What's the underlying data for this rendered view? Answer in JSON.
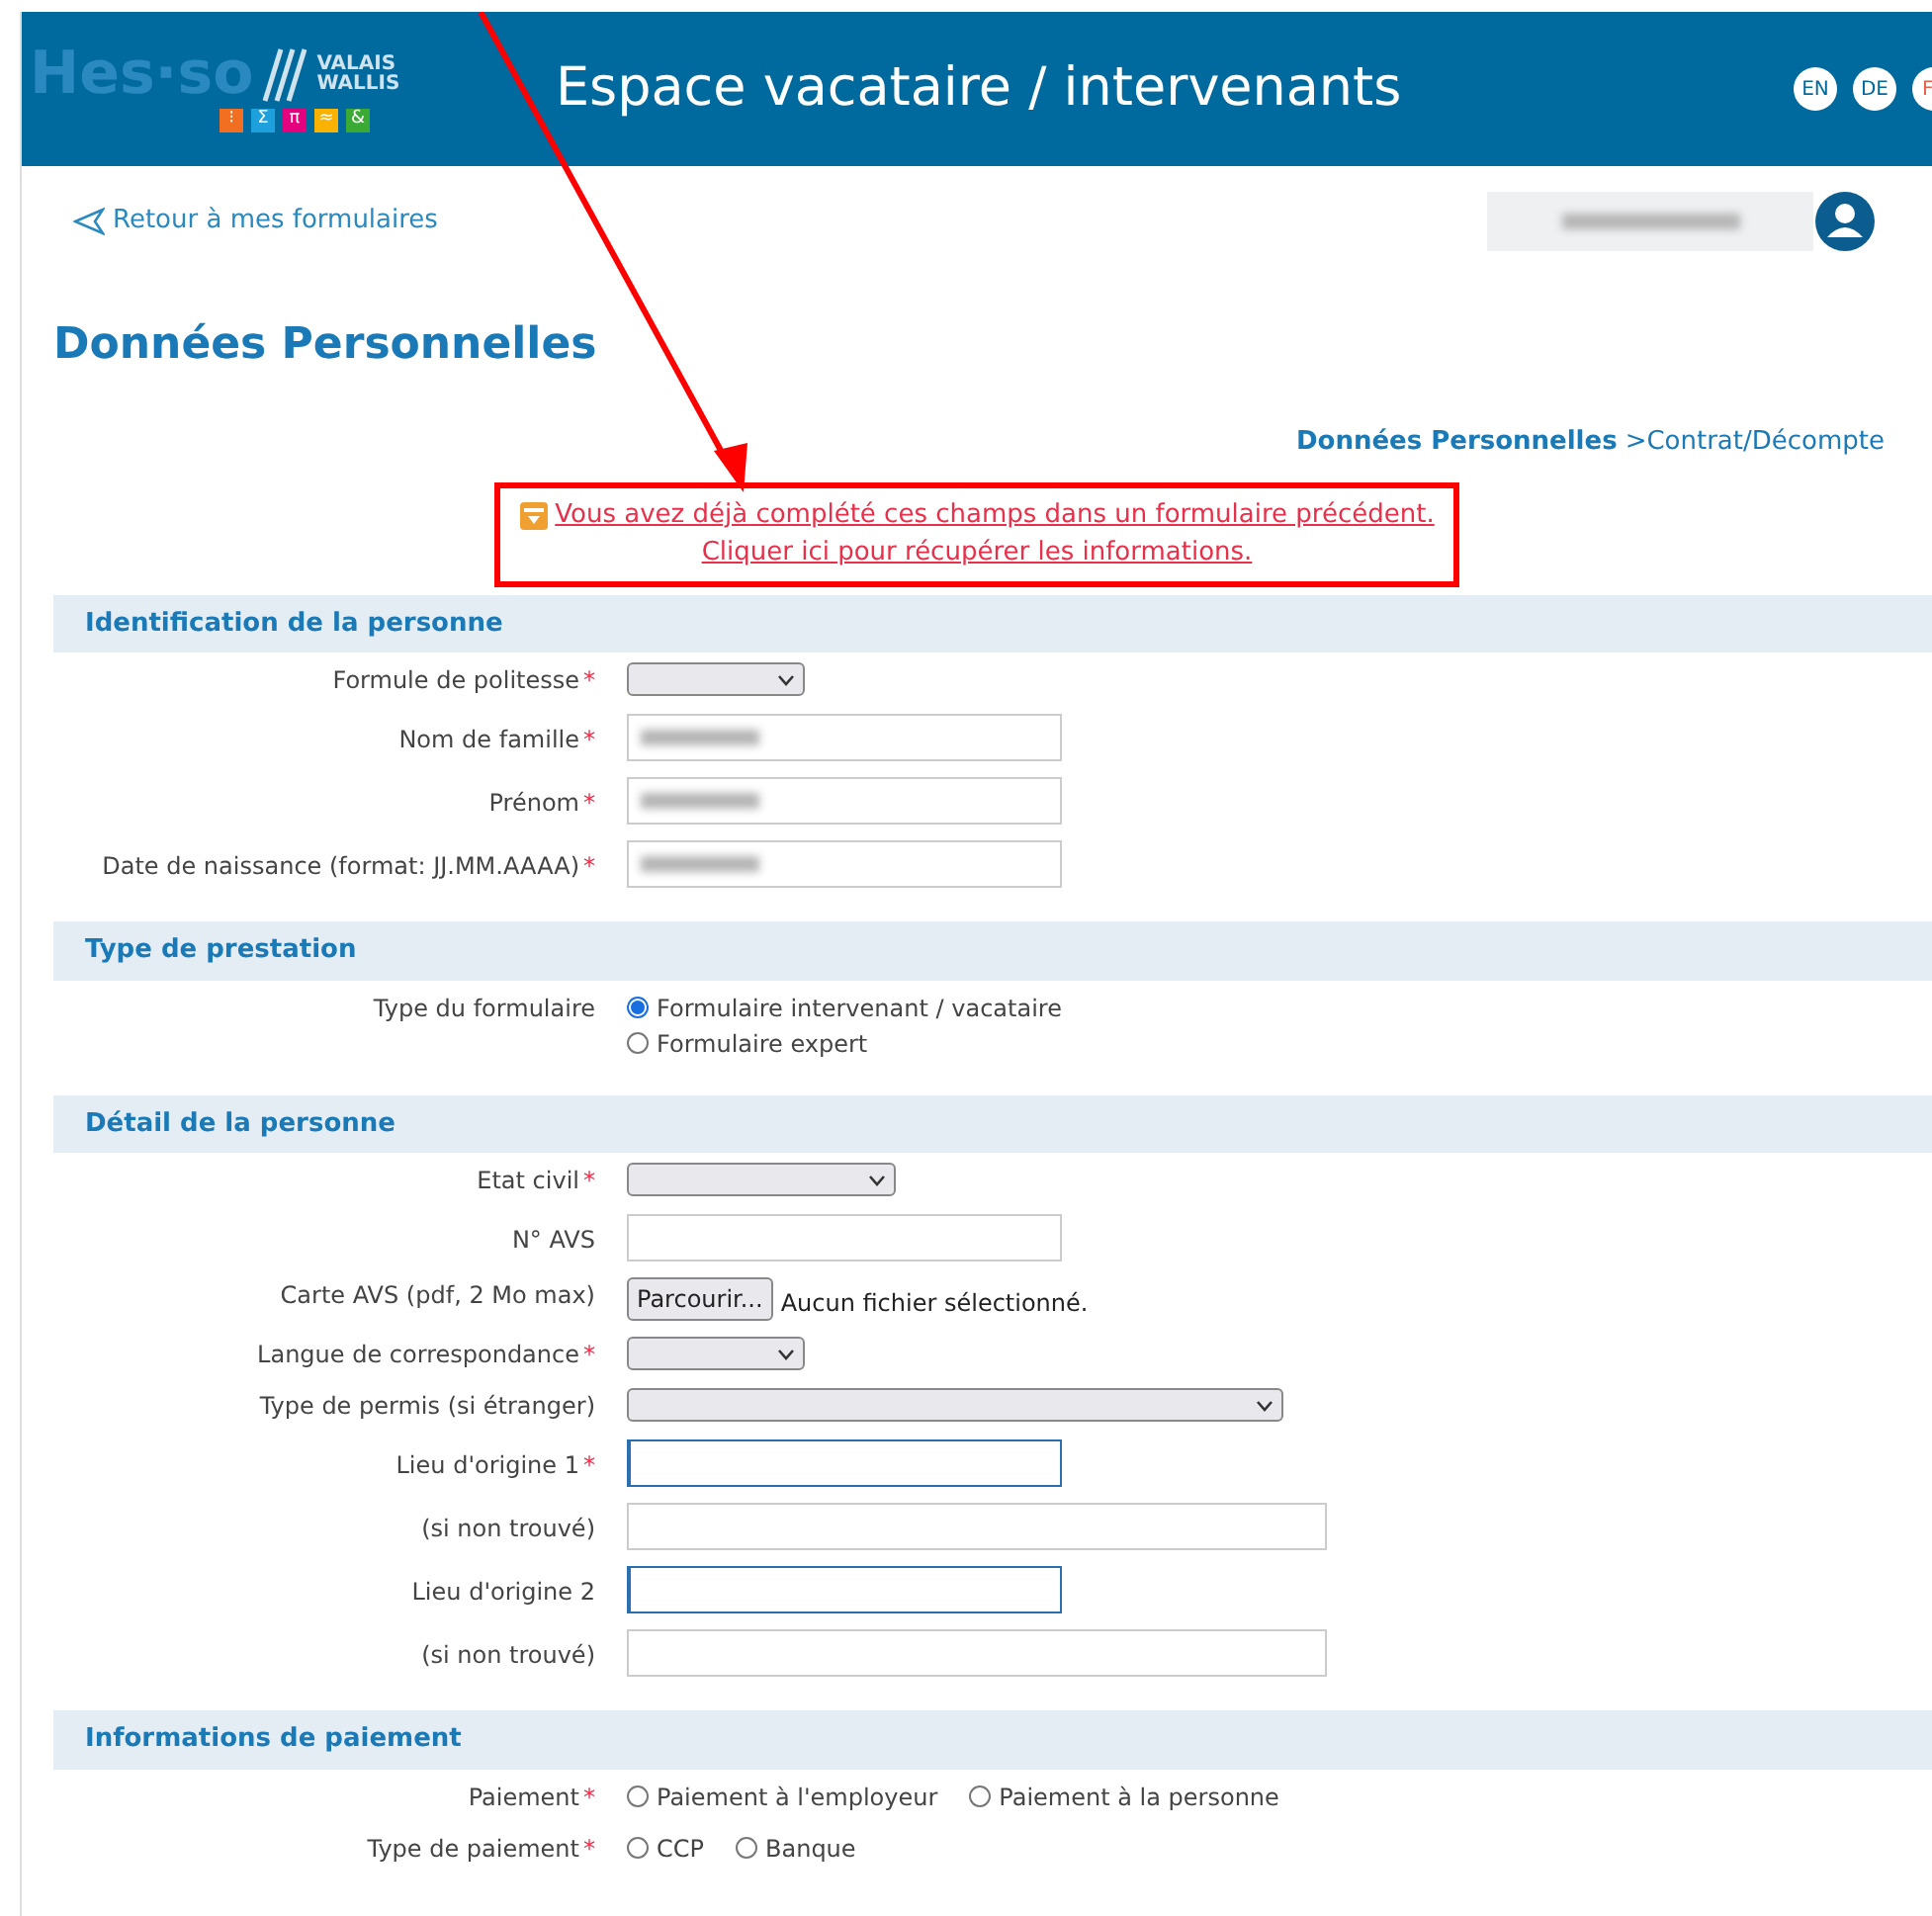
{
  "header": {
    "logo": {
      "wordmark": "Hes·so",
      "region_lines": [
        "VALAIS",
        "WALLIS"
      ],
      "tiles": [
        {
          "symbol": "⁝",
          "color": "#f26f21"
        },
        {
          "symbol": "Σ",
          "color": "#1ea0dc"
        },
        {
          "symbol": "π",
          "color": "#e5007e"
        },
        {
          "symbol": "≈",
          "color": "#f9b200"
        },
        {
          "symbol": "&",
          "color": "#3aaa35"
        }
      ]
    },
    "title": "Espace vacataire / intervenants",
    "languages": [
      "EN",
      "DE",
      "F"
    ]
  },
  "back_link": "Retour à mes formulaires",
  "user": {
    "blurred": true
  },
  "page_title": "Données Personnelles",
  "breadcrumb": [
    {
      "label": "Données Personnelles",
      "current": true
    },
    {
      "label": ">Contrat/Décompte",
      "current": false
    }
  ],
  "notice": {
    "lines": [
      "Vous avez déjà complété ces champs dans un formulaire précédent.",
      "Cliquer ici pour récupérer les informations."
    ],
    "highlighted": true
  },
  "sections": [
    {
      "title": "Identification de la personne",
      "fields": [
        {
          "label": "Formule de politesse",
          "marker": "*",
          "kind": "select-short"
        },
        {
          "label": "Nom de famille",
          "marker": "*",
          "kind": "text",
          "blurred": true
        },
        {
          "label": "Prénom",
          "marker": "*",
          "kind": "text",
          "blurred": true
        },
        {
          "label": "Date de naissance (format: JJ.MM.AAAA)",
          "marker": "*",
          "kind": "text",
          "blurred": true
        }
      ]
    },
    {
      "title": "Type de prestation",
      "fields": [
        {
          "label": "Type du formulaire",
          "kind": "radio-stacked",
          "options": [
            {
              "label": "Formulaire intervenant / vacataire",
              "selected": true
            },
            {
              "label": "Formulaire expert",
              "selected": false
            }
          ]
        }
      ]
    },
    {
      "title": "Détail de la personne",
      "fields": [
        {
          "label": "Etat civil",
          "marker": "*",
          "kind": "select-medium"
        },
        {
          "label": "N° AVS",
          "kind": "text"
        },
        {
          "label": "Carte AVS (pdf, 2 Mo max)",
          "kind": "file",
          "button": "Parcourir...",
          "status": "Aucun fichier sélectionné."
        },
        {
          "label": "Langue de correspondance",
          "marker": "*",
          "kind": "select-short"
        },
        {
          "label": "Type de permis (si étranger)",
          "kind": "select-long"
        },
        {
          "label": "Lieu d'origine 1",
          "marker": "*",
          "kind": "text",
          "active": true
        },
        {
          "label": "(si non trouvé)",
          "kind": "text-wide"
        },
        {
          "label": "Lieu d'origine 2",
          "kind": "text",
          "active": true
        },
        {
          "label": "(si non trouvé)",
          "kind": "text-wide"
        }
      ]
    },
    {
      "title": "Informations de paiement",
      "fields": [
        {
          "label": "Paiement",
          "marker": "*",
          "kind": "radio-inline",
          "options": [
            {
              "label": "Paiement à l'employeur",
              "selected": false
            },
            {
              "label": "Paiement à la personne",
              "selected": false
            }
          ]
        },
        {
          "label": "Type de paiement",
          "marker": "*",
          "kind": "radio-inline",
          "options": [
            {
              "label": "CCP",
              "selected": false
            },
            {
              "label": "Banque",
              "selected": false
            }
          ]
        }
      ]
    }
  ]
}
